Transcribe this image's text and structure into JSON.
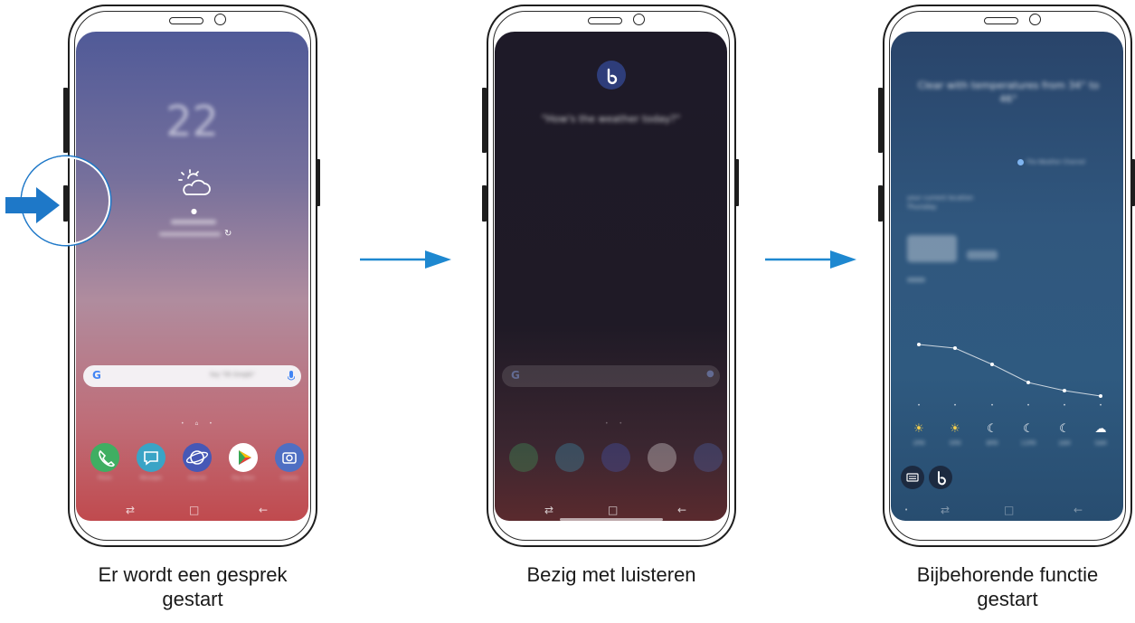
{
  "captions": {
    "step1_line1": "Er wordt een gesprek",
    "step1_line2": "gestart",
    "step2": "Bezig met luisteren",
    "step3_line1": "Bijbehorende functie",
    "step3_line2": "gestart"
  },
  "screen1": {
    "clock": "22",
    "search_placeholder": "Say \"Ok Google\"",
    "apps": [
      "Phone",
      "Messages",
      "Internet",
      "Play Store",
      "Camera"
    ]
  },
  "screen2": {
    "query": "\"How's the weather today?\""
  },
  "screen3": {
    "headline": "Clear with temperatures from 34° to 46°",
    "source": "The Weather Channel",
    "location": "your current location",
    "day": "Thursday",
    "hours": [
      "2PM",
      "5PM",
      "8PM",
      "11PM",
      "2AM",
      "5AM"
    ]
  },
  "colors": {
    "arrow": "#1e88d0",
    "press_arrow": "#1e78c8"
  }
}
